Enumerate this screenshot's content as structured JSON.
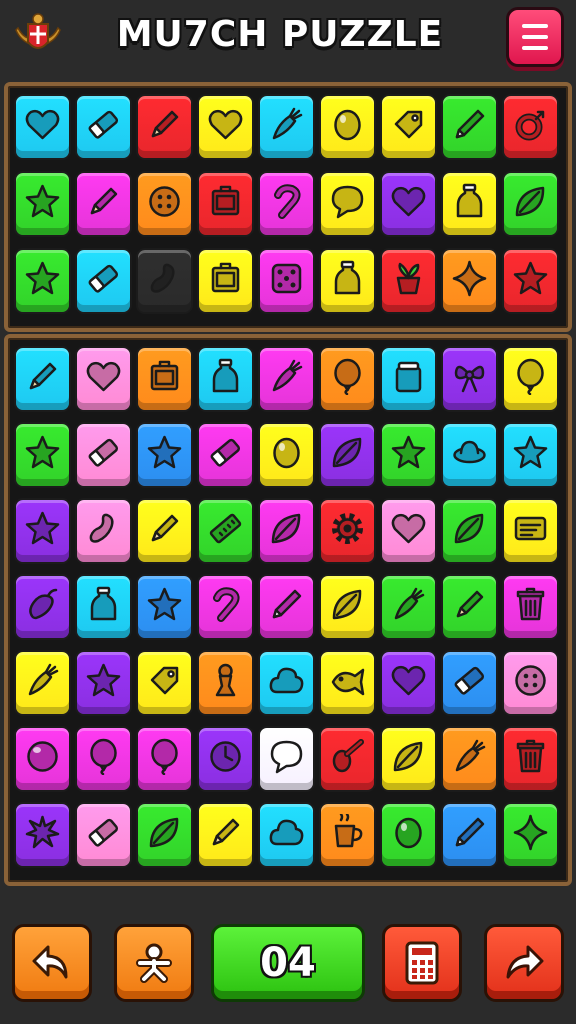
{
  "header": {
    "title": "MU7CH PUZZLE",
    "emblem_icon": "crest-emblem-icon",
    "menu_icon": "hamburger-menu-icon"
  },
  "palette": {
    "cyan": "#1ec8f0",
    "red": "#e8262c",
    "yellow": "#ffe81a",
    "green": "#32d22a",
    "magenta": "#e534d8",
    "orange": "#ff8a1c",
    "purple": "#8a2fe0",
    "pink": "#ff8ad4",
    "blue": "#2c8ef0",
    "black": "#2a2a2a",
    "white": "#f6f0ff"
  },
  "boards": {
    "top": {
      "rows": [
        [
          [
            "cyan",
            "heart-icon"
          ],
          [
            "cyan",
            "eraser-icon"
          ],
          [
            "red",
            "pencil-icon"
          ],
          [
            "yellow",
            "heart-icon"
          ],
          [
            "cyan",
            "carrot-icon"
          ],
          [
            "yellow",
            "egg-icon"
          ],
          [
            "yellow",
            "tag-icon"
          ],
          [
            "green",
            "pen-icon"
          ],
          [
            "red",
            "ring-icon"
          ]
        ],
        [
          [
            "green",
            "star-icon"
          ],
          [
            "magenta",
            "pencil-icon"
          ],
          [
            "orange",
            "button-icon"
          ],
          [
            "red",
            "box-icon"
          ],
          [
            "magenta",
            "hook-icon"
          ],
          [
            "yellow",
            "speech-bubble-icon"
          ],
          [
            "purple",
            "heart-icon"
          ],
          [
            "yellow",
            "bottle-icon"
          ],
          [
            "green",
            "leaf-icon"
          ]
        ],
        [
          [
            "green",
            "star-icon"
          ],
          [
            "cyan",
            "eraser-icon"
          ],
          [
            "black",
            "bean-icon"
          ],
          [
            "yellow",
            "box-icon"
          ],
          [
            "magenta",
            "dice-icon"
          ],
          [
            "yellow",
            "bottle-icon"
          ],
          [
            "red",
            "pot-plant-icon"
          ],
          [
            "orange",
            "sparkle-icon"
          ],
          [
            "red",
            "star-icon"
          ]
        ]
      ]
    },
    "bottom": {
      "rows": [
        [
          [
            "cyan",
            "pencil-icon"
          ],
          [
            "pink",
            "heart-icon"
          ],
          [
            "orange",
            "box-icon"
          ],
          [
            "cyan",
            "bottle-icon"
          ],
          [
            "magenta",
            "carrot-icon"
          ],
          [
            "orange",
            "balloon-icon"
          ],
          [
            "cyan",
            "jar-icon"
          ],
          [
            "purple",
            "bow-icon"
          ],
          [
            "yellow",
            "balloon-icon"
          ]
        ],
        [
          [
            "green",
            "star-icon"
          ],
          [
            "pink",
            "eraser-icon"
          ],
          [
            "blue",
            "star-icon"
          ],
          [
            "magenta",
            "eraser-icon"
          ],
          [
            "yellow",
            "egg-icon"
          ],
          [
            "purple",
            "leaf-icon"
          ],
          [
            "green",
            "star-icon"
          ],
          [
            "cyan",
            "ufo-icon"
          ],
          [
            "cyan",
            "star-icon"
          ]
        ],
        [
          [
            "purple",
            "star-icon"
          ],
          [
            "pink",
            "bean-icon"
          ],
          [
            "yellow",
            "pencil-icon"
          ],
          [
            "green",
            "ruler-icon"
          ],
          [
            "magenta",
            "leaf-icon"
          ],
          [
            "red",
            "gear-icon"
          ],
          [
            "pink",
            "heart-icon"
          ],
          [
            "green",
            "leaf-icon"
          ],
          [
            "yellow",
            "card-icon"
          ]
        ],
        [
          [
            "purple",
            "pepper-icon"
          ],
          [
            "cyan",
            "bottle-icon"
          ],
          [
            "blue",
            "star-icon"
          ],
          [
            "magenta",
            "hook-icon"
          ],
          [
            "magenta",
            "pen-icon"
          ],
          [
            "yellow",
            "leaf-icon"
          ],
          [
            "green",
            "carrot-icon"
          ],
          [
            "green",
            "pencil-icon"
          ],
          [
            "magenta",
            "trash-icon"
          ]
        ],
        [
          [
            "yellow",
            "carrot-icon"
          ],
          [
            "purple",
            "star-icon"
          ],
          [
            "yellow",
            "tag-icon"
          ],
          [
            "orange",
            "pawn-icon"
          ],
          [
            "cyan",
            "cloud-icon"
          ],
          [
            "yellow",
            "fish-icon"
          ],
          [
            "purple",
            "heart-icon"
          ],
          [
            "blue",
            "eraser-icon"
          ],
          [
            "pink",
            "button-icon"
          ]
        ],
        [
          [
            "magenta",
            "ball-icon"
          ],
          [
            "magenta",
            "balloon-icon"
          ],
          [
            "magenta",
            "balloon-icon"
          ],
          [
            "purple",
            "clock-icon"
          ],
          [
            "white",
            "speech-bubble-icon"
          ],
          [
            "red",
            "spoon-icon"
          ],
          [
            "yellow",
            "leaf-icon"
          ],
          [
            "orange",
            "carrot-icon"
          ],
          [
            "red",
            "trash-icon"
          ]
        ],
        [
          [
            "purple",
            "splat-icon"
          ],
          [
            "pink",
            "eraser-icon"
          ],
          [
            "green",
            "leaf-icon"
          ],
          [
            "yellow",
            "pencil-icon"
          ],
          [
            "cyan",
            "cloud-icon"
          ],
          [
            "orange",
            "cup-icon"
          ],
          [
            "green",
            "egg-icon"
          ],
          [
            "blue",
            "pen-icon"
          ],
          [
            "green",
            "sparkle-icon"
          ]
        ]
      ]
    }
  },
  "controls": {
    "undo_icon": "undo-arrow-icon",
    "hint_icon": "person-icon",
    "counter": "04",
    "calc_icon": "calculator-icon",
    "next_icon": "next-arrow-icon"
  }
}
